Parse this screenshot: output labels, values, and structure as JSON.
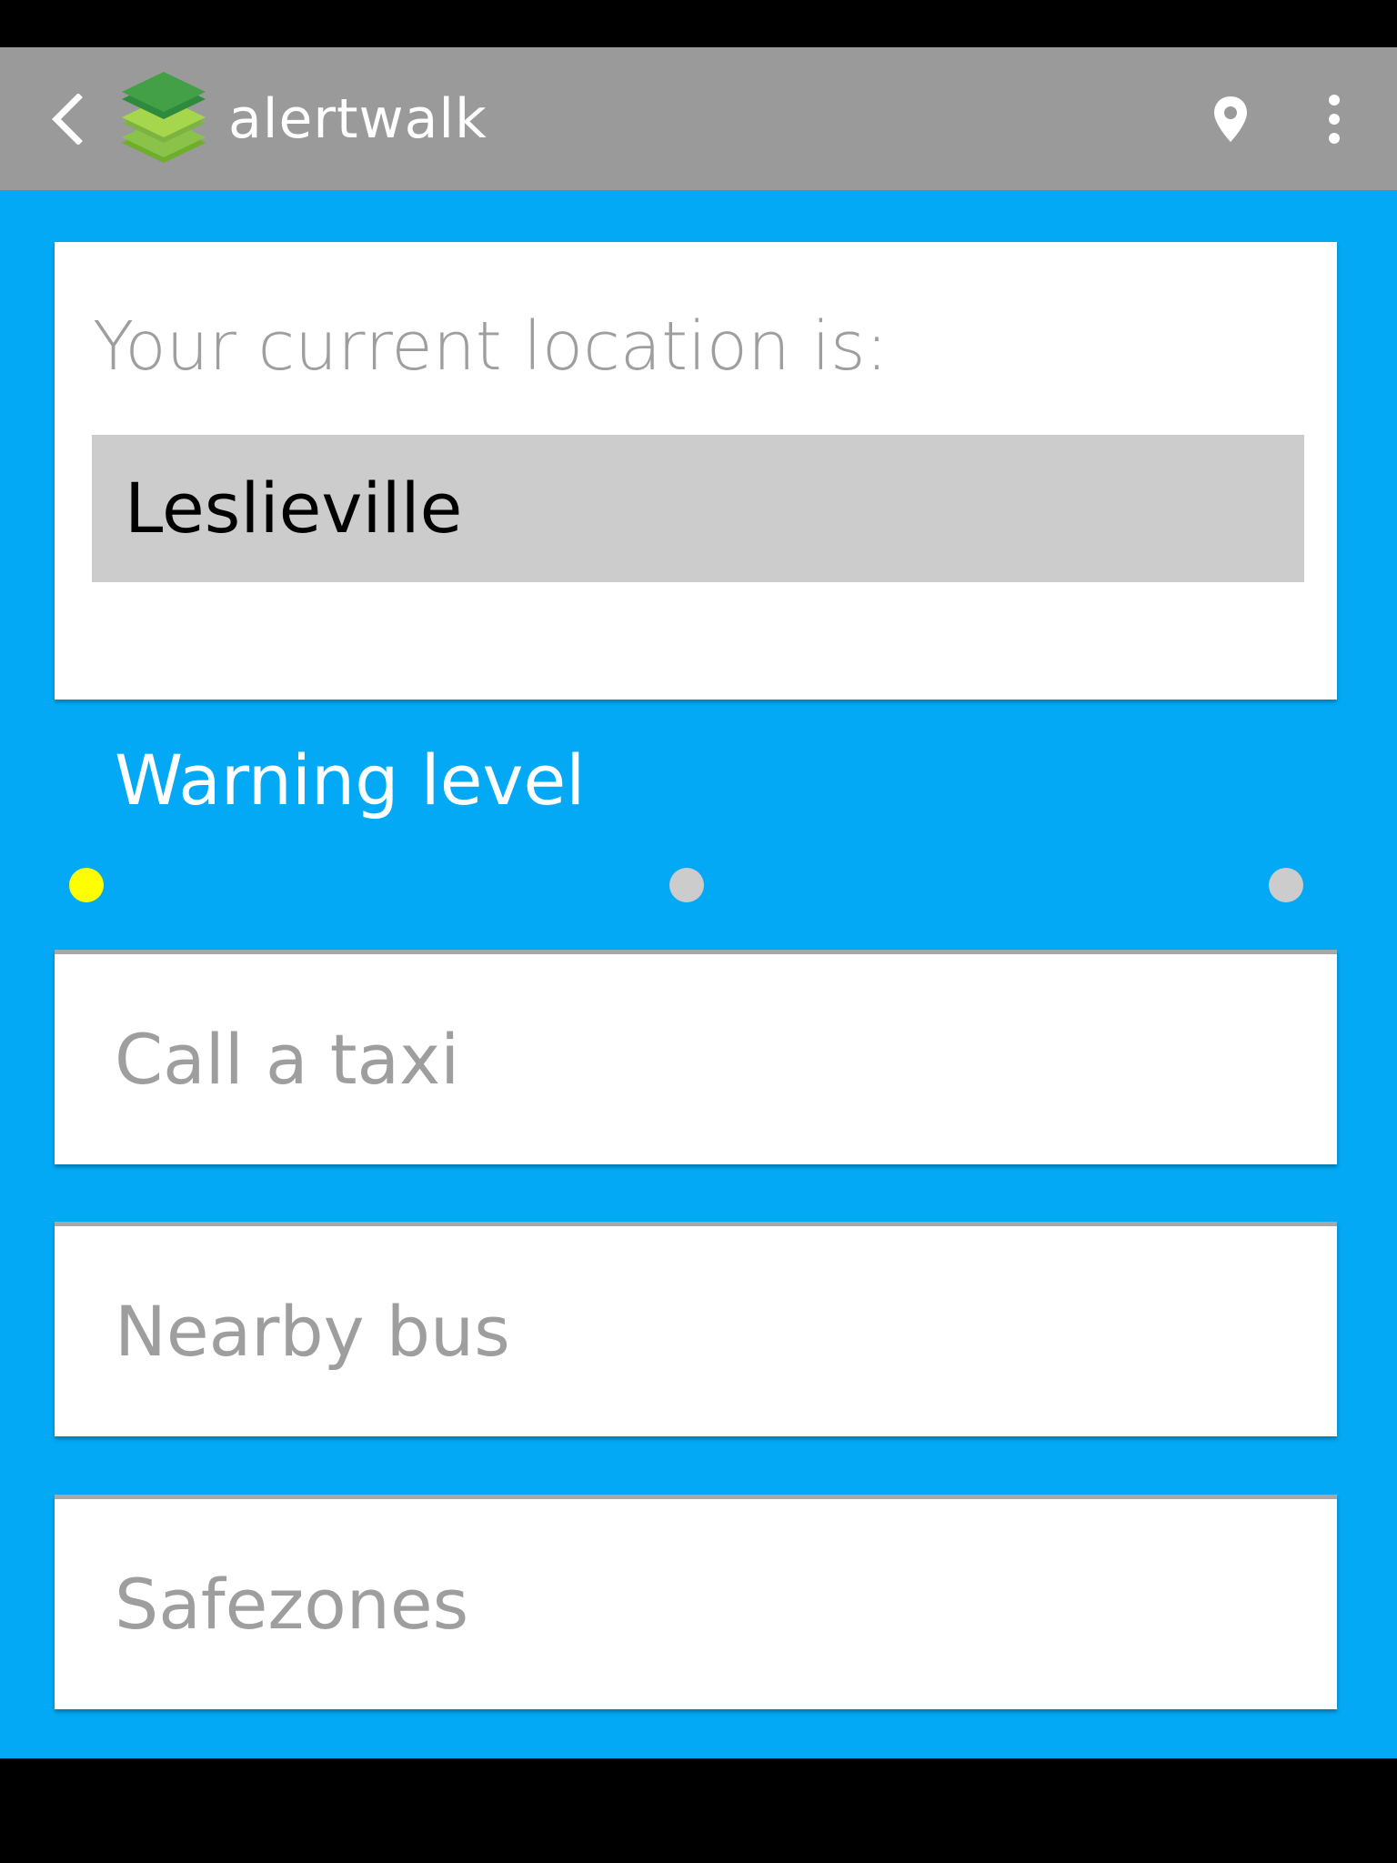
{
  "app": {
    "title": "alertwalk",
    "logo_icon": "layers-logo-icon",
    "header_color": "#9a9a9a",
    "accent_color": "#03a9f4"
  },
  "action_bar": {
    "back_icon": "chevron-left-icon",
    "location_icon": "map-pin-icon",
    "overflow_icon": "more-vertical-icon"
  },
  "location": {
    "label": "Your current location is:",
    "value": "Leslieville"
  },
  "warning": {
    "title": "Warning level",
    "levels": [
      {
        "color": "#ffff00",
        "selected": true
      },
      {
        "color": "#cccccc",
        "selected": false
      },
      {
        "color": "#cccccc",
        "selected": false
      }
    ]
  },
  "options": [
    {
      "label": "Call a taxi"
    },
    {
      "label": "Nearby bus"
    },
    {
      "label": "Safezones"
    }
  ]
}
